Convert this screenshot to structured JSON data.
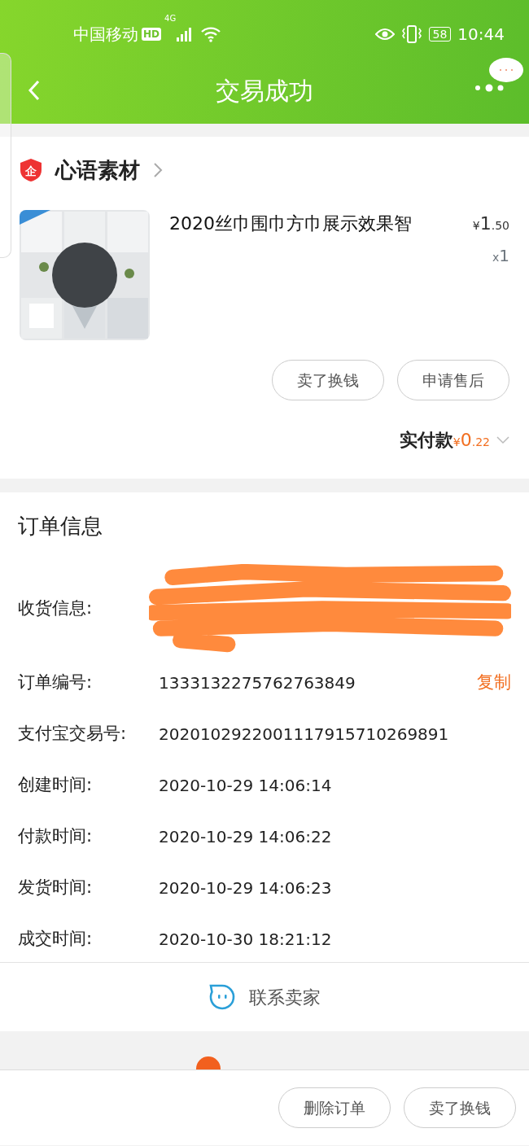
{
  "status_bar": {
    "carrier": "中国移动",
    "hd_badge": "HD",
    "network": "4G",
    "battery": "58",
    "time": "10:44"
  },
  "header": {
    "title": "交易成功"
  },
  "shop": {
    "name": "心语素材",
    "badge": "企"
  },
  "product": {
    "title": "2020丝巾围巾方巾展示效果智",
    "price": {
      "symbol": "¥",
      "integer": "1",
      "decimal": ".50"
    },
    "quantity": {
      "prefix": "x",
      "count": "1"
    }
  },
  "item_actions": [
    "卖了换钱",
    "申请售后"
  ],
  "payment": {
    "label": "实付款",
    "amount": {
      "symbol": "¥",
      "integer": "0",
      "decimal": ".22"
    },
    "expanded": false
  },
  "order_info": {
    "title": "订单信息",
    "rows": [
      {
        "kind": "redacted",
        "label": "收货信息:"
      },
      {
        "kind": "text",
        "label": "订单编号:",
        "value": "1333132275762763849",
        "action": "复制"
      },
      {
        "kind": "text",
        "label": "支付宝交易号:",
        "value": "2020102922001117915710269891"
      },
      {
        "kind": "text",
        "label": "创建时间:",
        "value": "2020-10-29 14:06:14"
      },
      {
        "kind": "text",
        "label": "付款时间:",
        "value": "2020-10-29 14:06:22"
      },
      {
        "kind": "text",
        "label": "发货时间:",
        "value": "2020-10-29 14:06:23"
      },
      {
        "kind": "text",
        "label": "成交时间:",
        "value": "2020-10-30 18:21:12"
      }
    ]
  },
  "contact": {
    "label": "联系卖家"
  },
  "bottom_actions": [
    "删除订单",
    "卖了换钱"
  ]
}
